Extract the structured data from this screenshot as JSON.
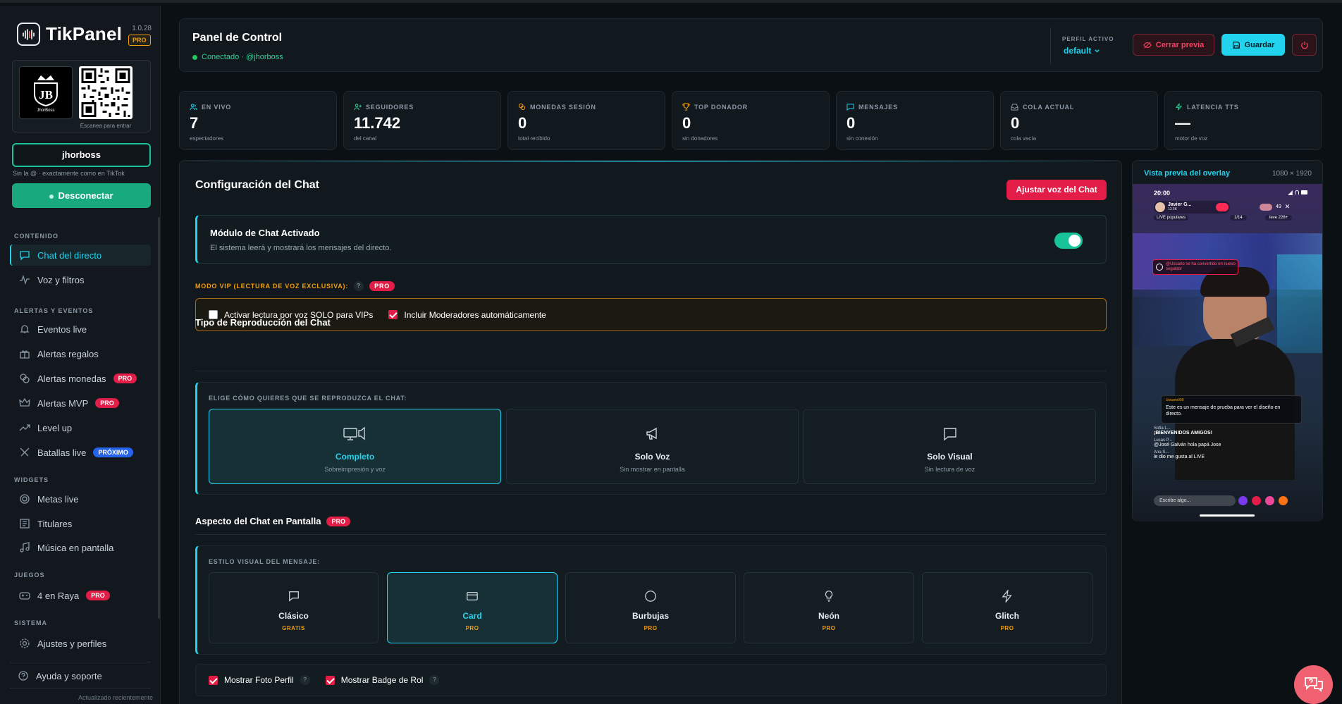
{
  "brand": {
    "name": "TikPanel",
    "version": "1.0.28",
    "tier": "PRO"
  },
  "profile": {
    "avatar_text": "JhorBoss",
    "qr_caption": "Escanea para entrar"
  },
  "user": {
    "username": "jhorboss",
    "hint": "Sin la @ · exactamente como en TikTok",
    "disconnect_label": "Desconectar"
  },
  "sidebar": {
    "sections": [
      {
        "label": "CONTENIDO"
      },
      {
        "label": "ALERTAS Y EVENTOS"
      },
      {
        "label": "WIDGETS"
      },
      {
        "label": "JUEGOS"
      },
      {
        "label": "SISTEMA"
      }
    ],
    "items": [
      {
        "label": "Chat del directo",
        "icon": "chat-icon"
      },
      {
        "label": "Voz y filtros",
        "icon": "waveform-icon"
      },
      {
        "label": "Eventos live",
        "icon": "bell-icon"
      },
      {
        "label": "Alertas regalos",
        "icon": "gift-icon"
      },
      {
        "label": "Alertas monedas",
        "icon": "coins-icon",
        "badge": "PRO"
      },
      {
        "label": "Alertas MVP",
        "icon": "crown-icon",
        "badge": "PRO"
      },
      {
        "label": "Level up",
        "icon": "trending-up-icon"
      },
      {
        "label": "Batallas live",
        "icon": "swords-icon",
        "badge": "PRÓXIMO"
      },
      {
        "label": "Metas live",
        "icon": "target-icon"
      },
      {
        "label": "Titulares",
        "icon": "newspaper-icon"
      },
      {
        "label": "Música en pantalla",
        "icon": "music-icon"
      },
      {
        "label": "4 en Raya",
        "icon": "gamepad-icon",
        "badge": "PRO"
      },
      {
        "label": "Ajustes y perfiles",
        "icon": "gear-icon"
      },
      {
        "label": "Ayuda y soporte",
        "icon": "help-circle-icon"
      }
    ],
    "updated": "Actualizado recientemente"
  },
  "header": {
    "title": "Panel de Control",
    "status": "Conectado · @jhorboss",
    "profile_label": "PERFIL ACTIVO",
    "profile_value": "default",
    "close_preview": "Cerrar previa",
    "save": "Guardar"
  },
  "stats": [
    {
      "label": "EN VIVO",
      "value": "7",
      "sub": "espectadores",
      "icon": "users-icon"
    },
    {
      "label": "SEGUIDORES",
      "value": "11.742",
      "sub": "del canal",
      "icon": "user-plus-icon"
    },
    {
      "label": "MONEDAS SESIÓN",
      "value": "0",
      "sub": "total recibido",
      "icon": "coins-icon"
    },
    {
      "label": "TOP DONADOR",
      "value": "0",
      "sub": "sin donadores",
      "icon": "trophy-icon"
    },
    {
      "label": "MENSAJES",
      "value": "0",
      "sub": "sin conexión",
      "icon": "message-icon"
    },
    {
      "label": "COLA ACTUAL",
      "value": "0",
      "sub": "cola vacía",
      "icon": "inbox-icon"
    },
    {
      "label": "LATENCIA TTS",
      "value": "—",
      "sub": "motor de voz",
      "icon": "zap-icon"
    }
  ],
  "main": {
    "title": "Configuración del Chat",
    "voice_button": "Ajustar voz del Chat",
    "module": {
      "title": "Módulo de Chat Activado",
      "desc": "El sistema leerá y mostrará los mensajes del directo.",
      "enabled": true
    },
    "vip": {
      "label": "MODO VIP (LECTURA DE VOZ EXCLUSIVA):",
      "help": "?",
      "badge": "PRO",
      "opt1": "Activar lectura por voz SOLO para VIPs",
      "opt1_checked": false,
      "opt2": "Incluir Moderadores automáticamente",
      "opt2_checked": true
    },
    "playback": {
      "title": "Tipo de Reproducción del Chat",
      "label": "ELIGE CÓMO QUIERES QUE SE REPRODUZCA EL CHAT:",
      "options": [
        {
          "title": "Completo",
          "sub": "Sobreimpresión y voz",
          "icon": "monitor-speaker-icon",
          "selected": true
        },
        {
          "title": "Solo Voz",
          "sub": "Sin mostrar en pantalla",
          "icon": "megaphone-icon",
          "selected": false
        },
        {
          "title": "Solo Visual",
          "sub": "Sin lectura de voz",
          "icon": "chat-bubble-icon",
          "selected": false
        }
      ]
    },
    "appearance": {
      "title": "Aspecto del Chat en Pantalla",
      "badge": "PRO",
      "label": "ESTILO VISUAL DEL MENSAJE:",
      "styles": [
        {
          "title": "Clásico",
          "tier": "GRATIS",
          "icon": "chat-bubble-icon",
          "selected": false
        },
        {
          "title": "Card",
          "tier": "PRO",
          "icon": "card-icon",
          "selected": true
        },
        {
          "title": "Burbujas",
          "tier": "PRO",
          "icon": "circle-icon",
          "selected": false
        },
        {
          "title": "Neón",
          "tier": "PRO",
          "icon": "lightbulb-icon",
          "selected": false
        },
        {
          "title": "Glitch",
          "tier": "PRO",
          "icon": "zap-icon",
          "selected": false
        }
      ]
    },
    "bottom": {
      "opt1": "Mostrar Foto Perfil",
      "opt2": "Mostrar Badge de Rol",
      "help": "?"
    }
  },
  "preview": {
    "title": "Vista previa del overlay",
    "size": "1080 × 1920",
    "phone": {
      "time": "20:00",
      "host": "Javier G...",
      "host_sub": "13.5K",
      "live_tag": "LIVE populares",
      "viewers": "49",
      "rank": "1/14",
      "rank2": "leve 226+",
      "alert_text": "@Usuario se ha convertido en nuevo seguidor",
      "overlay_user": "Usuario999",
      "overlay_msg": "Este es un mensaje de prueba para ver el diseño en directo.",
      "comments": [
        {
          "name": "Sofia L...",
          "text": "¡BIENVENIDOS AMIGOS!"
        },
        {
          "name": "Lucas P...",
          "text": "@José Galván hola papá Jose"
        },
        {
          "name": "Ana S...",
          "text": "le dio me gusta al LIVE"
        }
      ],
      "input_placeholder": "Escribe algo..."
    }
  }
}
